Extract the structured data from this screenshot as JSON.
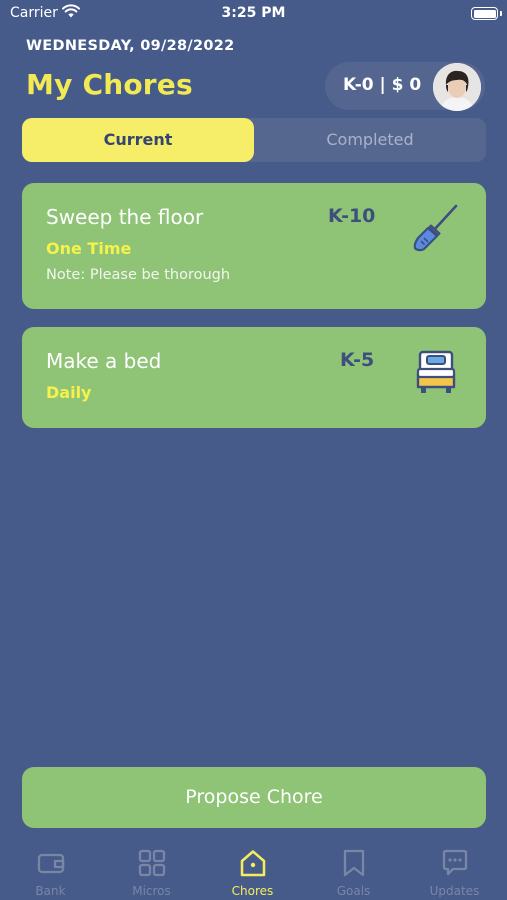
{
  "status_bar": {
    "carrier": "Carrier",
    "time": "3:25 PM"
  },
  "header": {
    "date": "WEDNESDAY, 09/28/2022",
    "title": "My Chores",
    "balance": "K-0 | $ 0"
  },
  "tabs": {
    "current": "Current",
    "completed": "Completed"
  },
  "chores": [
    {
      "name": "Sweep the floor",
      "points": "K-10",
      "frequency": "One Time",
      "note": "Note: Please be thorough",
      "icon": "broom-icon"
    },
    {
      "name": "Make a bed",
      "points": "K-5",
      "frequency": "Daily",
      "note": "",
      "icon": "bed-icon"
    }
  ],
  "actions": {
    "propose": "Propose Chore"
  },
  "nav": [
    {
      "label": "Bank",
      "icon": "wallet-icon"
    },
    {
      "label": "Micros",
      "icon": "grid-icon"
    },
    {
      "label": "Chores",
      "icon": "home-icon"
    },
    {
      "label": "Goals",
      "icon": "bookmark-icon"
    },
    {
      "label": "Updates",
      "icon": "chat-icon"
    }
  ],
  "colors": {
    "background": "#465b8a",
    "accent_yellow": "#f6ee69",
    "card_green": "#8fc477",
    "points_navy": "#3c4f7d",
    "inactive_nav": "#7986a6"
  }
}
